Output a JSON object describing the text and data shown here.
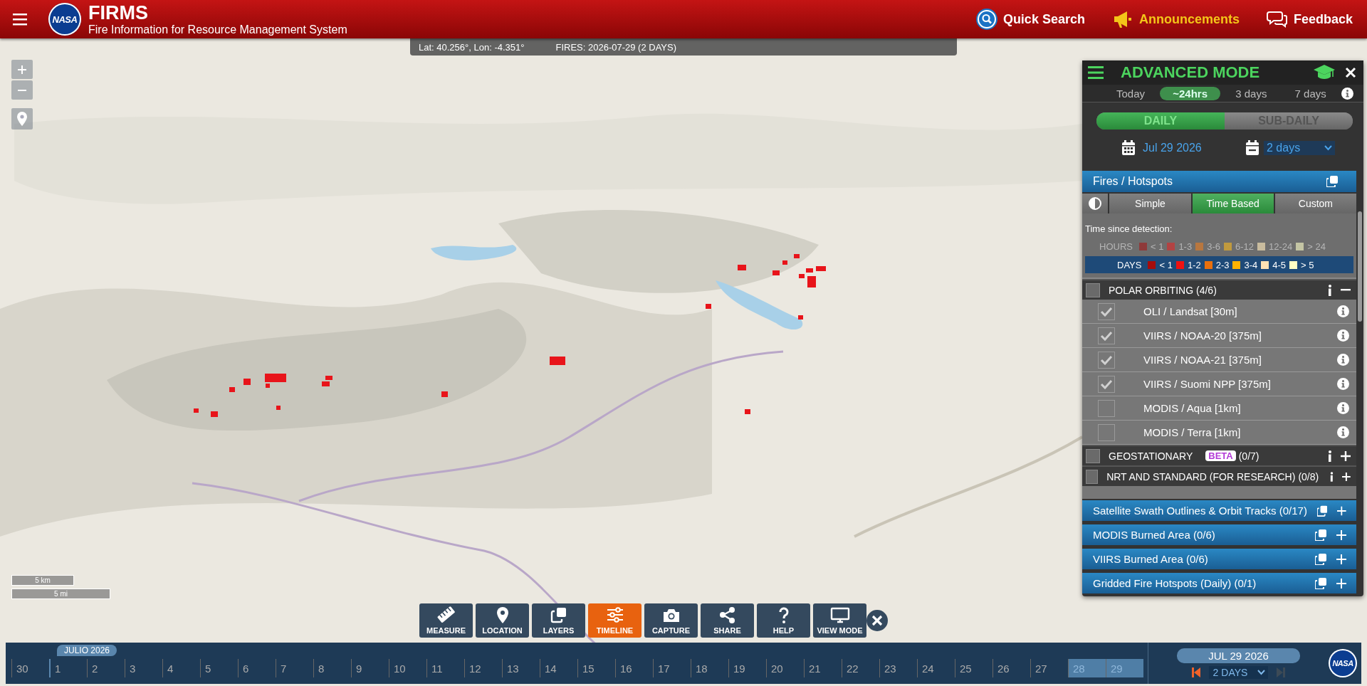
{
  "header": {
    "logo": "NASA",
    "title": "FIRMS",
    "subtitle": "Fire Information for Resource Management System",
    "actions": [
      {
        "kind": "search",
        "label": "Quick Search"
      },
      {
        "kind": "announce",
        "label": "Announcements"
      },
      {
        "kind": "feedback",
        "label": "Feedback"
      }
    ]
  },
  "info_bar": {
    "coords": "Lat: 40.256°, Lon: -4.351°",
    "fires": "FIRES: 2026-07-29 (2 DAYS)"
  },
  "scale": [
    "5 km",
    "5 mi"
  ],
  "panel": {
    "title": "ADVANCED MODE",
    "ranges": [
      {
        "label": "Today",
        "selected": false
      },
      {
        "label": "~24hrs",
        "selected": true
      },
      {
        "label": "3 days",
        "selected": false
      },
      {
        "label": "7 days",
        "selected": false
      }
    ],
    "modes": [
      {
        "label": "DAILY",
        "selected": true
      },
      {
        "label": "SUB-DAILY",
        "selected": false
      }
    ],
    "date": "Jul 29 2026",
    "duration": "2 days",
    "section": "Fires / Hotspots",
    "styles": [
      {
        "label": "Simple",
        "selected": false
      },
      {
        "label": "Time Based",
        "selected": true
      },
      {
        "label": "Custom",
        "selected": false
      }
    ],
    "legend": {
      "caption": "Time since detection:",
      "hours": {
        "label": "HOURS",
        "items": [
          {
            "label": "< 1",
            "color": "#8e3a3a"
          },
          {
            "label": "1-3",
            "color": "#b24343"
          },
          {
            "label": "3-6",
            "color": "#b8773f"
          },
          {
            "label": "6-12",
            "color": "#c19a3e"
          },
          {
            "label": "12-24",
            "color": "#c9bc9e"
          },
          {
            "label": "> 24",
            "color": "#c4c5a4"
          }
        ]
      },
      "days": {
        "label": "DAYS",
        "items": [
          {
            "label": "< 1",
            "color": "#a50c0c"
          },
          {
            "label": "1-2",
            "color": "#ee1111"
          },
          {
            "label": "2-3",
            "color": "#e8700e"
          },
          {
            "label": "3-4",
            "color": "#ffb300"
          },
          {
            "label": "4-5",
            "color": "#ffe2b4"
          },
          {
            "label": "> 5",
            "color": "#ffffc4"
          }
        ]
      }
    },
    "groups": [
      {
        "title": "POLAR ORBITING",
        "count": "(4/6)",
        "checked": false,
        "expanded": true,
        "items": [
          {
            "label": "OLI / Landsat [30m]",
            "checked": true
          },
          {
            "label": "VIIRS / NOAA-20 [375m]",
            "checked": true
          },
          {
            "label": "VIIRS / NOAA-21 [375m]",
            "checked": true
          },
          {
            "label": "VIIRS / Suomi NPP [375m]",
            "checked": true
          },
          {
            "label": "MODIS / Aqua [1km]",
            "checked": false
          },
          {
            "label": "MODIS / Terra [1km]",
            "checked": false
          }
        ]
      },
      {
        "title": "GEOSTATIONARY",
        "badge": "BETA",
        "count": "(0/7)",
        "checked": false,
        "expanded": false
      },
      {
        "title": "NRT AND STANDARD (FOR RESEARCH)",
        "count": "(0/8)",
        "checked": false,
        "expanded": false
      }
    ],
    "layers": [
      "Satellite Swath Outlines & Orbit Tracks (0/17)",
      "MODIS Burned Area (0/6)",
      "VIIRS Burned Area (0/6)",
      "Gridded Fire Hotspots (Daily) (0/1)"
    ]
  },
  "toolbar": [
    {
      "kind": "measure",
      "label": "MEASURE",
      "selected": false
    },
    {
      "kind": "location",
      "label": "LOCATION",
      "selected": false
    },
    {
      "kind": "layers",
      "label": "LAYERS",
      "selected": false
    },
    {
      "kind": "timeline",
      "label": "TIMELINE",
      "selected": true
    },
    {
      "kind": "capture",
      "label": "CAPTURE",
      "selected": false
    },
    {
      "kind": "share",
      "label": "SHARE",
      "selected": false
    },
    {
      "kind": "help",
      "label": "HELP",
      "selected": false
    },
    {
      "kind": "viewmode",
      "label": "VIEW MODE",
      "selected": false
    }
  ],
  "timeline": {
    "month": "JULIO 2026",
    "current_date": "JUL 29 2026",
    "duration": "2 DAYS",
    "logo": "NASA",
    "days": [
      {
        "label": "30",
        "selected": false
      },
      {
        "label": "1",
        "selected": false
      },
      {
        "label": "2",
        "selected": false
      },
      {
        "label": "3",
        "selected": false
      },
      {
        "label": "4",
        "selected": false
      },
      {
        "label": "5",
        "selected": false
      },
      {
        "label": "6",
        "selected": false
      },
      {
        "label": "7",
        "selected": false
      },
      {
        "label": "8",
        "selected": false
      },
      {
        "label": "9",
        "selected": false
      },
      {
        "label": "10",
        "selected": false
      },
      {
        "label": "11",
        "selected": false
      },
      {
        "label": "12",
        "selected": false
      },
      {
        "label": "13",
        "selected": false
      },
      {
        "label": "14",
        "selected": false
      },
      {
        "label": "15",
        "selected": false
      },
      {
        "label": "16",
        "selected": false
      },
      {
        "label": "17",
        "selected": false
      },
      {
        "label": "18",
        "selected": false
      },
      {
        "label": "19",
        "selected": false
      },
      {
        "label": "20",
        "selected": false
      },
      {
        "label": "21",
        "selected": false
      },
      {
        "label": "22",
        "selected": false
      },
      {
        "label": "23",
        "selected": false
      },
      {
        "label": "24",
        "selected": false
      },
      {
        "label": "25",
        "selected": false
      },
      {
        "label": "26",
        "selected": false
      },
      {
        "label": "27",
        "selected": false
      },
      {
        "label": "28",
        "selected": true
      },
      {
        "label": "29",
        "selected": true
      }
    ]
  }
}
